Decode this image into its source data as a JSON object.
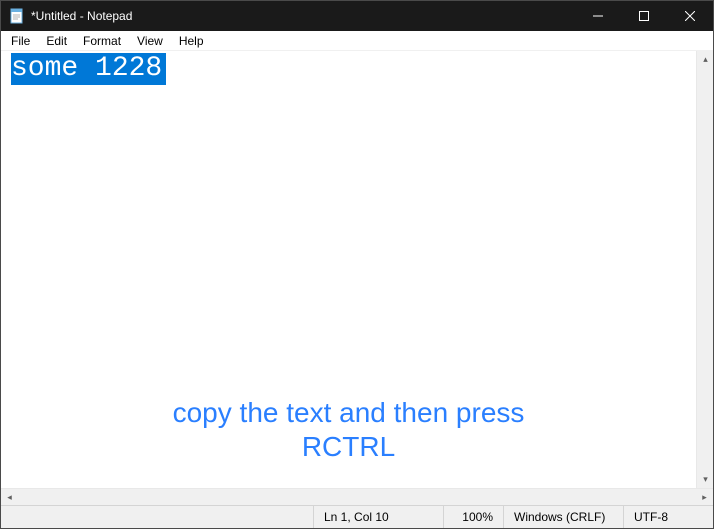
{
  "window": {
    "title": "*Untitled - Notepad"
  },
  "menu": {
    "file": "File",
    "edit": "Edit",
    "format": "Format",
    "view": "View",
    "help": "Help"
  },
  "editor": {
    "selected_text": "some 1228"
  },
  "instruction": {
    "line1": "copy the text and then press",
    "line2": "RCTRL"
  },
  "status": {
    "position": "Ln 1, Col 10",
    "zoom": "100%",
    "line_ending": "Windows (CRLF)",
    "encoding": "UTF-8"
  }
}
